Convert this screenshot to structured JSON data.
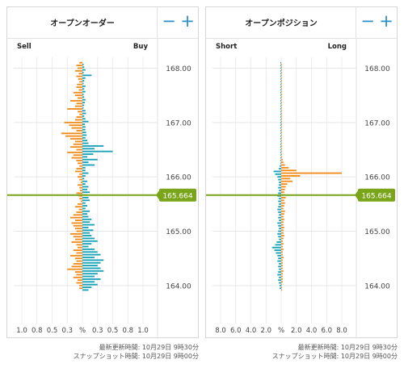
{
  "panels": [
    {
      "title": "オープンオーダー",
      "left_label": "Sell",
      "right_label": "Buy",
      "zoom_out": "−",
      "zoom_in": "+",
      "x_ticks": [
        "1.0",
        "0.8",
        "0.5",
        "0.3",
        "%",
        "0.3",
        "0.5",
        "0.8",
        "1.0"
      ],
      "footer_updated": "最新更新時間: 10月29日 9時30分",
      "footer_snapshot": "スナップショット時間: 10月29日 9時00分"
    },
    {
      "title": "オープンポジション",
      "left_label": "Short",
      "right_label": "Long",
      "zoom_out": "−",
      "zoom_in": "+",
      "x_ticks": [
        "8.0",
        "6.0",
        "4.0",
        "2.0",
        "%",
        "2.0",
        "4.0",
        "6.0",
        "8.0"
      ],
      "footer_updated": "最新更新時間: 10月29日 9時30分",
      "footer_snapshot": "スナップショット時間: 10月29日 9時00分"
    }
  ],
  "price_axis": [
    "168.00",
    "167.00",
    "166.00",
    "165.00",
    "164.00"
  ],
  "current_price": "165.664",
  "colors": {
    "accent": "#2a8fc5",
    "buy_bar": "#1aa3b8",
    "sell_bar": "#f28c1c",
    "price_line": "#7aa51a",
    "grid": "#e6e6e6"
  },
  "chart_data": [
    {
      "type": "bar",
      "name": "open-orders",
      "price_range": [
        163.3,
        168.2
      ],
      "current_price": 165.664,
      "x_range_percent": [
        -1.0,
        1.0
      ],
      "bar_step": 0.05,
      "sell_percent": [
        0.05,
        0.1,
        0.08,
        0.12,
        0.06,
        0.1,
        0.07,
        0.05,
        0.09,
        0.1,
        0.06,
        0.15,
        0.12,
        0.08,
        0.2,
        0.1,
        0.12,
        0.25,
        0.08,
        0.05,
        0.1,
        0.12,
        0.3,
        0.22,
        0.18,
        0.1,
        0.35,
        0.28,
        0.2,
        0.12,
        0.15,
        0.2,
        0.1,
        0.25,
        0.15,
        0.18,
        0.1,
        0.08,
        0.05,
        0.1,
        0.12,
        0.05,
        0.08,
        0.05,
        0.03,
        0.08,
        0.05,
        0.04,
        0.1,
        0.06,
        0.05,
        0.03,
        0.08,
        0.12,
        0.06,
        0.1,
        0.15,
        0.2,
        0.12,
        0.18,
        0.15,
        0.12,
        0.1,
        0.2,
        0.15,
        0.12,
        0.18,
        0.1,
        0.08,
        0.15,
        0.1,
        0.2,
        0.12,
        0.1,
        0.15,
        0.18,
        0.25,
        0.12,
        0.1,
        0.15,
        0.08,
        0.1,
        0.05,
        0.05
      ],
      "buy_percent": [
        0.02,
        0.03,
        0.05,
        0.02,
        0.15,
        0.05,
        0.03,
        0.02,
        0.05,
        0.03,
        0.05,
        0.02,
        0.03,
        0.05,
        0.04,
        0.03,
        0.02,
        0.05,
        0.06,
        0.03,
        0.05,
        0.1,
        0.04,
        0.05,
        0.05,
        0.06,
        0.07,
        0.05,
        0.08,
        0.1,
        0.35,
        0.2,
        0.5,
        0.18,
        0.08,
        0.25,
        0.1,
        0.2,
        0.05,
        0.05,
        0.1,
        0.05,
        0.03,
        0.08,
        0.05,
        0.1,
        0.08,
        0.12,
        0.08,
        0.1,
        0.12,
        0.05,
        0.08,
        0.05,
        0.12,
        0.08,
        0.1,
        0.15,
        0.12,
        0.2,
        0.1,
        0.18,
        0.12,
        0.15,
        0.2,
        0.25,
        0.15,
        0.1,
        0.2,
        0.25,
        0.3,
        0.2,
        0.35,
        0.3,
        0.25,
        0.3,
        0.35,
        0.25,
        0.2,
        0.3,
        0.2,
        0.25,
        0.15,
        0.1
      ]
    },
    {
      "type": "bar",
      "name": "open-positions",
      "price_range": [
        163.3,
        168.2
      ],
      "current_price": 165.664,
      "x_range_percent": [
        -8.0,
        8.0
      ],
      "bar_step": 0.05,
      "short_percent": [
        0.1,
        0.1,
        0.1,
        0.1,
        0.1,
        0.1,
        0.1,
        0.1,
        0.1,
        0.1,
        0.1,
        0.1,
        0.1,
        0.1,
        0.1,
        0.1,
        0.1,
        0.1,
        0.1,
        0.1,
        0.1,
        0.1,
        0.1,
        0.1,
        0.1,
        0.1,
        0.1,
        0.1,
        0.1,
        0.1,
        0.1,
        0.1,
        0.1,
        0.1,
        0.1,
        0.1,
        0.1,
        0.1,
        0.2,
        0.3,
        1.0,
        0.8,
        0.5,
        0.4,
        0.3,
        0.3,
        0.4,
        0.3,
        0.4,
        0.5,
        0.3,
        0.4,
        0.3,
        0.4,
        0.5,
        0.4,
        0.3,
        0.4,
        0.3,
        0.5,
        0.4,
        0.3,
        0.4,
        0.5,
        0.4,
        0.3,
        0.6,
        0.8,
        1.2,
        0.9,
        0.7,
        0.5,
        0.4,
        0.5,
        0.3,
        0.4,
        0.3,
        0.4,
        0.5,
        0.3,
        0.4,
        0.3,
        0.2,
        0.2
      ],
      "long_percent": [
        0.1,
        0.1,
        0.1,
        0.1,
        0.1,
        0.1,
        0.1,
        0.1,
        0.1,
        0.1,
        0.1,
        0.1,
        0.1,
        0.1,
        0.1,
        0.1,
        0.1,
        0.1,
        0.1,
        0.1,
        0.1,
        0.1,
        0.1,
        0.1,
        0.1,
        0.1,
        0.1,
        0.1,
        0.1,
        0.1,
        0.1,
        0.1,
        0.1,
        0.1,
        0.1,
        0.2,
        0.3,
        0.5,
        1.0,
        2.0,
        8.0,
        2.5,
        1.2,
        1.5,
        0.8,
        0.6,
        0.5,
        0.4,
        0.5,
        0.6,
        0.4,
        0.5,
        0.4,
        0.3,
        0.5,
        0.4,
        0.3,
        0.4,
        0.3,
        0.3,
        0.4,
        0.3,
        0.3,
        0.4,
        0.3,
        0.2,
        0.3,
        0.2,
        0.3,
        0.2,
        0.2,
        0.3,
        0.2,
        0.2,
        0.2,
        0.2,
        0.3,
        0.2,
        0.2,
        0.2,
        0.2,
        0.1,
        0.1,
        0.1
      ]
    }
  ]
}
